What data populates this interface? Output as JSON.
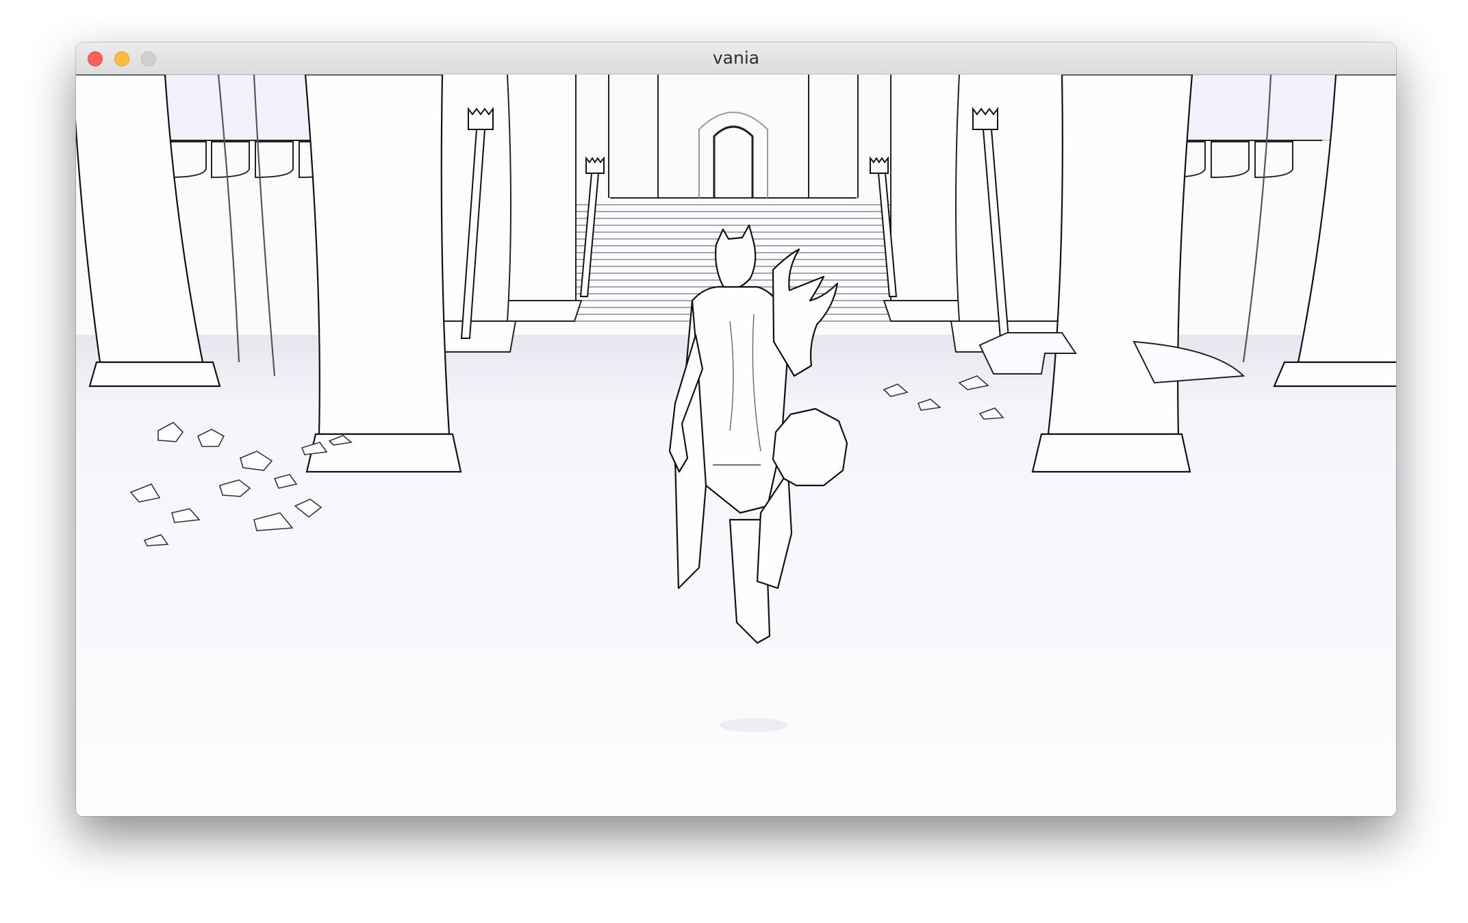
{
  "window": {
    "title": "vania"
  },
  "scene": {
    "style": "outline-render",
    "icons": [
      "close-icon",
      "minimize-icon",
      "zoom-icon"
    ]
  },
  "colors": {
    "close": "#fc605c",
    "minimize": "#fdbc40",
    "zoom": "#d0d0d0",
    "outline": "#111111",
    "background": "#fbfbfd"
  }
}
